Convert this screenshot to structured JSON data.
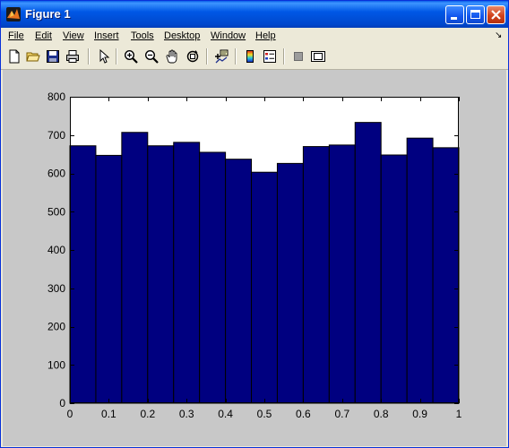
{
  "window": {
    "title": "Figure 1"
  },
  "menu": [
    "File",
    "Edit",
    "View",
    "Insert",
    "Tools",
    "Desktop",
    "Window",
    "Help"
  ],
  "menu_overflow": "↘",
  "toolbar_icons": [
    "new-figure-icon",
    "open-file-icon",
    "save-icon",
    "print-icon",
    "edit-plot-arrow-icon",
    "zoom-in-icon",
    "zoom-out-icon",
    "pan-hand-icon",
    "rotate-3d-icon",
    "data-cursor-icon",
    "colorbar-icon",
    "legend-icon",
    "hide-plot-tools-icon",
    "show-plot-tools-icon"
  ],
  "colors": {
    "bar_fill": "#000080",
    "figure_bg": "#C8C8C8",
    "axes_bg": "#FFFFFF"
  },
  "chart_data": {
    "type": "bar",
    "title": "",
    "xlabel": "",
    "ylabel": "",
    "xlim": [
      0,
      1
    ],
    "ylim": [
      0,
      800
    ],
    "xticks": [
      "0",
      "0.1",
      "0.2",
      "0.3",
      "0.4",
      "0.5",
      "0.6",
      "0.7",
      "0.8",
      "0.9",
      "1"
    ],
    "yticks": [
      "0",
      "100",
      "200",
      "300",
      "400",
      "500",
      "600",
      "700",
      "800"
    ],
    "bin_edges": [
      0,
      0.0667,
      0.1333,
      0.2,
      0.2667,
      0.3333,
      0.4,
      0.4667,
      0.5333,
      0.6,
      0.6667,
      0.7333,
      0.8,
      0.8667,
      0.9333,
      1
    ],
    "values": [
      672,
      647,
      707,
      672,
      681,
      655,
      637,
      603,
      626,
      670,
      674,
      733,
      648,
      692,
      667
    ],
    "grid": false,
    "legend": "none"
  }
}
